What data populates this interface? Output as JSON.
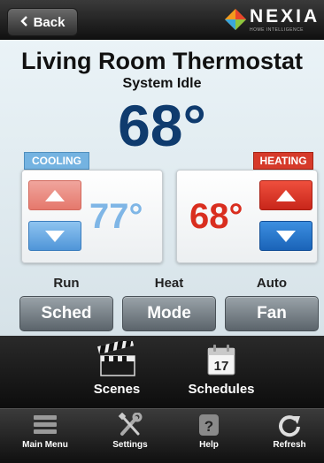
{
  "header": {
    "back_label": "Back",
    "logo": {
      "word": "NEXIA",
      "tagline": "HOME INTELLIGENCE"
    }
  },
  "thermostat": {
    "title": "Living Room Thermostat",
    "status": "System Idle",
    "current_temp": "68°",
    "cooling": {
      "tag": "COOLING",
      "setpoint": "77°"
    },
    "heating": {
      "tag": "HEATING",
      "setpoint": "68°"
    }
  },
  "modes": {
    "labels": [
      "Run",
      "Heat",
      "Auto"
    ],
    "buttons": [
      "Sched",
      "Mode",
      "Fan"
    ]
  },
  "actions": [
    {
      "label": "Scenes",
      "icon": "clapperboard-icon"
    },
    {
      "label": "Schedules",
      "icon": "calendar-icon",
      "day": "17"
    }
  ],
  "tabbar": [
    {
      "label": "Main Menu",
      "icon": "menu-icon"
    },
    {
      "label": "Settings",
      "icon": "tools-icon"
    },
    {
      "label": "Help",
      "icon": "help-icon"
    },
    {
      "label": "Refresh",
      "icon": "refresh-icon"
    }
  ],
  "colors": {
    "temp_blue": "#0f3b6e",
    "cool_blue": "#7fb6e6",
    "heat_red": "#d92e1f"
  }
}
